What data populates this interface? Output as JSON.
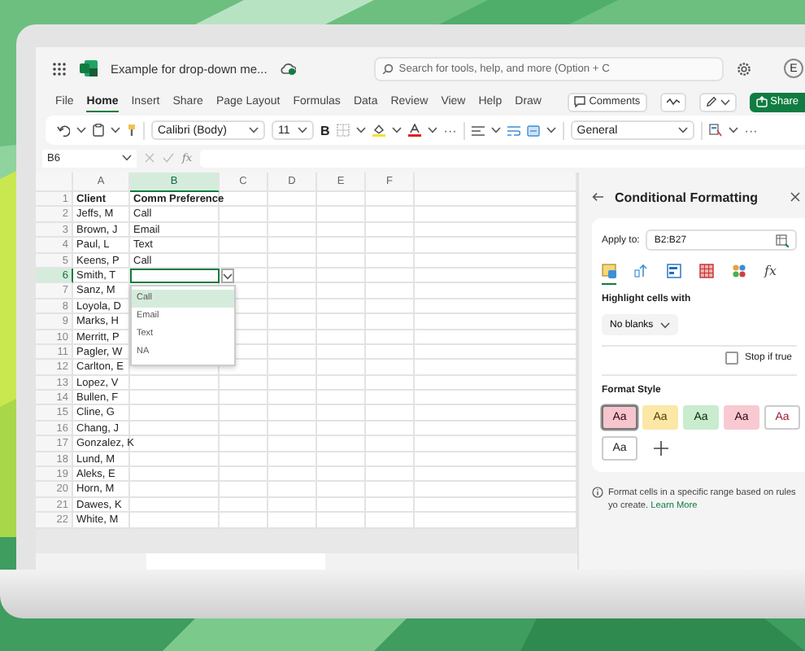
{
  "window": {
    "title": "Example for drop-down me...",
    "search": {
      "placeholder": "Search for tools, help, and more (Option + C"
    },
    "avatar": "E"
  },
  "menu_tabs": [
    {
      "label": "File",
      "selected": false
    },
    {
      "label": "Home",
      "selected": true
    },
    {
      "label": "Insert",
      "selected": false
    },
    {
      "label": "Share",
      "selected": false
    },
    {
      "label": "Page Layout",
      "selected": false
    },
    {
      "label": "Formulas",
      "selected": false
    },
    {
      "label": "Data",
      "selected": false
    },
    {
      "label": "Review",
      "selected": false
    },
    {
      "label": "View",
      "selected": false
    },
    {
      "label": "Help",
      "selected": false
    },
    {
      "label": "Draw",
      "selected": false
    }
  ],
  "menu_buttons": {
    "comments": "Comments",
    "share": "Share"
  },
  "toolbar": {
    "font": "Calibri (Body)",
    "size": "11",
    "bold": "B",
    "overflow": "···",
    "number_format": "General",
    "overflow_2": "···"
  },
  "formula_bar": {
    "name_box": "B6",
    "function_label": "fx"
  },
  "sheet": {
    "columns": [
      {
        "label": "A",
        "selected": false
      },
      {
        "label": "B",
        "selected": true
      },
      {
        "label": "C",
        "selected": false
      },
      {
        "label": "D",
        "selected": false
      },
      {
        "label": "E",
        "selected": false
      },
      {
        "label": "F",
        "selected": false
      }
    ],
    "rows": [
      {
        "number": "1",
        "kind": "header",
        "selected": false,
        "cells": [
          "Client",
          "Comm Preference"
        ]
      },
      {
        "number": "2",
        "kind": "data",
        "selected": false,
        "cells": [
          "Jeffs, M",
          "Call"
        ]
      },
      {
        "number": "3",
        "kind": "data",
        "selected": false,
        "cells": [
          "Brown, J",
          "Email"
        ]
      },
      {
        "number": "4",
        "kind": "data",
        "selected": false,
        "cells": [
          "Paul, L",
          "Text"
        ]
      },
      {
        "number": "5",
        "kind": "data",
        "selected": false,
        "cells": [
          "Keens, P",
          "Call"
        ]
      },
      {
        "number": "6",
        "kind": "data",
        "selected": true,
        "cells": [
          "Smith, T"
        ]
      },
      {
        "number": "7",
        "kind": "data",
        "selected": false,
        "cells": [
          "Sanz, M"
        ]
      },
      {
        "number": "8",
        "kind": "data",
        "selected": false,
        "cells": [
          "Loyola, D"
        ]
      },
      {
        "number": "9",
        "kind": "data",
        "selected": false,
        "cells": [
          "Marks, H"
        ]
      },
      {
        "number": "10",
        "kind": "data",
        "selected": false,
        "cells": [
          "Merritt, P"
        ]
      },
      {
        "number": "11",
        "kind": "data",
        "selected": false,
        "cells": [
          "Pagler, W"
        ]
      },
      {
        "number": "12",
        "kind": "data",
        "selected": false,
        "cells": [
          "Carlton, E"
        ]
      },
      {
        "number": "13",
        "kind": "data",
        "selected": false,
        "cells": [
          "Lopez, V"
        ]
      },
      {
        "number": "14",
        "kind": "data",
        "selected": false,
        "cells": [
          "Bullen, F"
        ]
      },
      {
        "number": "15",
        "kind": "data",
        "selected": false,
        "cells": [
          "Cline, G"
        ]
      },
      {
        "number": "16",
        "kind": "data",
        "selected": false,
        "cells": [
          "Chang, J"
        ]
      },
      {
        "number": "17",
        "kind": "data",
        "selected": false,
        "cells": [
          "Gonzalez, K"
        ]
      },
      {
        "number": "18",
        "kind": "data",
        "selected": false,
        "cells": [
          "Lund, M"
        ]
      },
      {
        "number": "19",
        "kind": "data",
        "selected": false,
        "cells": [
          "Aleks, E"
        ]
      },
      {
        "number": "20",
        "kind": "data",
        "selected": false,
        "cells": [
          "Horn, M"
        ]
      },
      {
        "number": "21",
        "kind": "data",
        "selected": false,
        "cells": [
          "Dawes, K"
        ]
      },
      {
        "number": "22",
        "kind": "data",
        "selected": false,
        "cells": [
          "White, M"
        ]
      }
    ],
    "dropdown": [
      {
        "label": "Call",
        "selected": true
      },
      {
        "label": "Email",
        "selected": false
      },
      {
        "label": "Text",
        "selected": false
      },
      {
        "label": "NA",
        "selected": false
      }
    ]
  },
  "pane": {
    "title": "Conditional Formatting",
    "apply_to_label": "Apply to:",
    "apply_to_value": "B2:B27",
    "rule_tabs": [
      {
        "selected": true
      },
      {
        "selected": false
      },
      {
        "selected": false
      },
      {
        "selected": false
      },
      {
        "selected": false
      },
      {
        "selected": false,
        "label": "fx"
      }
    ],
    "highlight_label": "Highlight cells with",
    "rule": "No blanks",
    "stop_if_true": {
      "label": "Stop if true",
      "checked": false
    },
    "format_style_label": "Format Style",
    "styles": [
      {
        "sample": "Aa",
        "color": "#f7c5cd",
        "selected": true
      },
      {
        "sample": "Aa",
        "color": "#fbe8a6",
        "selected": false
      },
      {
        "sample": "Aa",
        "color": "#c9eccf",
        "selected": false
      },
      {
        "sample": "Aa",
        "color": "#f9c9d2",
        "selected": false
      },
      {
        "sample": "Aa",
        "color": "#ffffff",
        "selected": false
      },
      {
        "sample": "Aa",
        "color": "#ffffff",
        "selected": false
      }
    ],
    "info": "Format cells in a specific range based on rules yo create.",
    "link": "Learn More"
  }
}
